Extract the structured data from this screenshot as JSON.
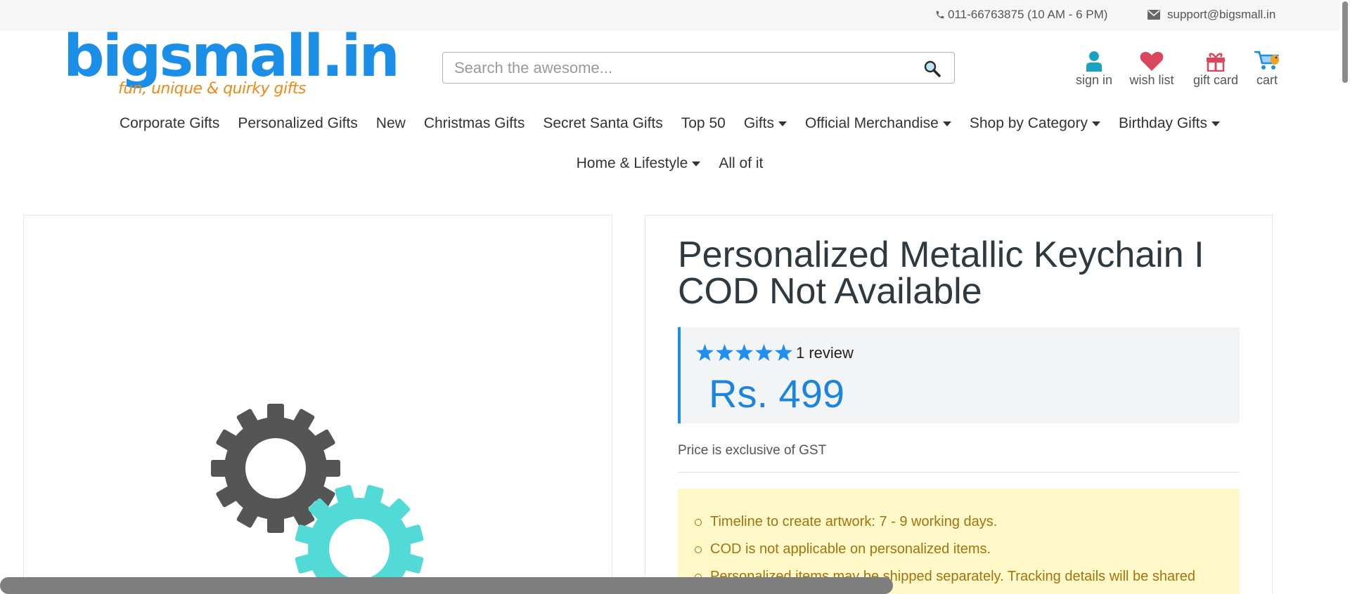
{
  "topbar": {
    "phone": "011-66763875 (10 AM - 6 PM)",
    "email": "support@bigsmall.in"
  },
  "logo": {
    "wordmark": "bigsmall.in",
    "tagline": "fun, unique & quirky gifts"
  },
  "search": {
    "placeholder": "Search the awesome..."
  },
  "header_links": {
    "sign_in": "sign in",
    "wish_list": "wish list",
    "gift_card": "gift card",
    "cart": "cart"
  },
  "nav": {
    "row1": [
      {
        "label": "Corporate Gifts",
        "dropdown": false
      },
      {
        "label": "Personalized Gifts",
        "dropdown": false
      },
      {
        "label": "New",
        "dropdown": false
      },
      {
        "label": "Christmas Gifts",
        "dropdown": false
      },
      {
        "label": "Secret Santa Gifts",
        "dropdown": false
      },
      {
        "label": "Top 50",
        "dropdown": false
      },
      {
        "label": "Gifts",
        "dropdown": true
      },
      {
        "label": "Official Merchandise",
        "dropdown": true
      },
      {
        "label": "Shop by Category",
        "dropdown": true
      },
      {
        "label": "Birthday Gifts",
        "dropdown": true
      }
    ],
    "row2": [
      {
        "label": "Home & Lifestyle",
        "dropdown": true
      },
      {
        "label": "All of it",
        "dropdown": false
      }
    ]
  },
  "product": {
    "title": "Personalized Metallic Keychain I COD Not Available",
    "rating": 5,
    "review_text": "1 review",
    "price": "Rs. 499",
    "gst_note": "Price is exclusive of GST",
    "notes": [
      "Timeline to create artwork: 7 - 9 working days.",
      "COD is not applicable on personalized items.",
      "Personalized items may be shipped separately. Tracking details will be shared"
    ]
  },
  "colors": {
    "brand_blue": "#1b8fe8",
    "brand_orange": "#f08a16",
    "price_blue": "#1b84df",
    "star_blue": "#1f8ff0",
    "note_bg": "#fff8c9",
    "note_text": "#a17410",
    "gear_dark": "#555555",
    "gear_teal": "#52dbd6"
  },
  "icons": {
    "phone": "phone-icon",
    "email": "envelope-icon",
    "search": "search-icon",
    "sign_in": "user-icon",
    "wish_list": "heart-icon",
    "gift_card": "gift-icon",
    "cart": "cart-icon",
    "loading": "gears-icon"
  }
}
